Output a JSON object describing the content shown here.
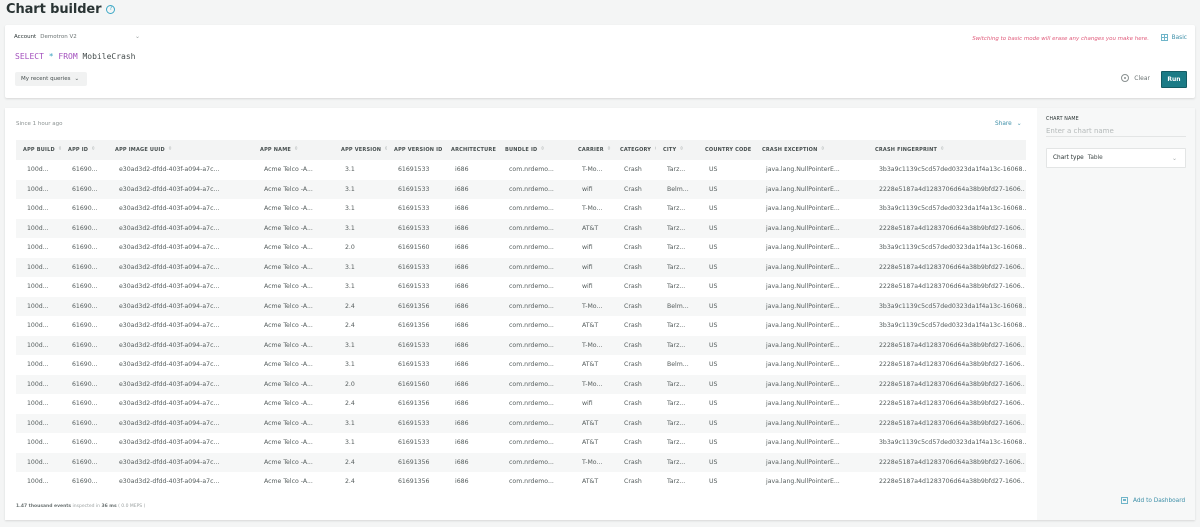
{
  "header": {
    "title": "Chart builder",
    "help_icon": "?"
  },
  "query": {
    "account_label": "Account",
    "account_value": "Demotron V2",
    "account_chevron": "⌄",
    "nrql": {
      "select": "SELECT",
      "star": "*",
      "from": "FROM",
      "table": "MobileCrash"
    },
    "recent_queries_label": "My recent queries",
    "recent_chevron": "⌄",
    "warning": "Switching to basic mode will erase any changes you make here.",
    "basic_label": "Basic",
    "clear_label": "Clear",
    "run_label": "Run",
    "accent_color": "#1b7b86"
  },
  "results": {
    "since": "Since 1 hour ago",
    "share_label": "Share",
    "share_chevron": "⌄",
    "sort_glyph": "⇳",
    "columns": [
      "APP BUILD",
      "APP ID",
      "APP IMAGE UUID",
      "APP NAME",
      "APP VERSION",
      "APP VERSION ID",
      "ARCHITECTURE",
      "BUNDLE ID",
      "CARRIER",
      "CATEGORY",
      "CITY",
      "COUNTRY CODE",
      "CRASH EXCEPTION",
      "CRASH FINGERPRINT"
    ],
    "rows": [
      [
        "100d...",
        "61690...",
        "e30ad3d2-dfdd-403f-a094-a7c...",
        "Acme Telco -A...",
        "3.1",
        "61691533",
        "i686",
        "com.nrdemo...",
        "T-Mo...",
        "Crash",
        "Tarz...",
        "US",
        "java.lang.NullPointerE...",
        "3b3a9c1139c5cd57ded0323da1f4a13c-16068.."
      ],
      [
        "100d...",
        "61690...",
        "e30ad3d2-dfdd-403f-a094-a7c...",
        "Acme Telco -A...",
        "3.1",
        "61691533",
        "i686",
        "com.nrdemo...",
        "wifi",
        "Crash",
        "Belm...",
        "US",
        "java.lang.NullPointerE...",
        "2228e5187a4d1283706d64a38b9bfd27-1606.."
      ],
      [
        "100d...",
        "61690...",
        "e30ad3d2-dfdd-403f-a094-a7c...",
        "Acme Telco -A...",
        "3.1",
        "61691533",
        "i686",
        "com.nrdemo...",
        "T-Mo...",
        "Crash",
        "Tarz...",
        "US",
        "java.lang.NullPointerE...",
        "3b3a9c1139c5cd57ded0323da1f4a13c-16068.."
      ],
      [
        "100d...",
        "61690...",
        "e30ad3d2-dfdd-403f-a094-a7c...",
        "Acme Telco -A...",
        "3.1",
        "61691533",
        "i686",
        "com.nrdemo...",
        "AT&T",
        "Crash",
        "Tarz...",
        "US",
        "java.lang.NullPointerE...",
        "2228e5187a4d1283706d64a38b9bfd27-1606.."
      ],
      [
        "100d...",
        "61690...",
        "e30ad3d2-dfdd-403f-a094-a7c...",
        "Acme Telco -A...",
        "2.0",
        "61691560",
        "i686",
        "com.nrdemo...",
        "wifi",
        "Crash",
        "Tarz...",
        "US",
        "java.lang.NullPointerE...",
        "3b3a9c1139c5cd57ded0323da1f4a13c-16068.."
      ],
      [
        "100d...",
        "61690...",
        "e30ad3d2-dfdd-403f-a094-a7c...",
        "Acme Telco -A...",
        "3.1",
        "61691533",
        "i686",
        "com.nrdemo...",
        "wifi",
        "Crash",
        "Tarz...",
        "US",
        "java.lang.NullPointerE...",
        "2228e5187a4d1283706d64a38b9bfd27-1606.."
      ],
      [
        "100d...",
        "61690...",
        "e30ad3d2-dfdd-403f-a094-a7c...",
        "Acme Telco -A...",
        "3.1",
        "61691533",
        "i686",
        "com.nrdemo...",
        "wifi",
        "Crash",
        "Tarz...",
        "US",
        "java.lang.NullPointerE...",
        "2228e5187a4d1283706d64a38b9bfd27-1606.."
      ],
      [
        "100d...",
        "61690...",
        "e30ad3d2-dfdd-403f-a094-a7c...",
        "Acme Telco -A...",
        "2.4",
        "61691356",
        "i686",
        "com.nrdemo...",
        "T-Mo...",
        "Crash",
        "Belm...",
        "US",
        "java.lang.NullPointerE...",
        "3b3a9c1139c5cd57ded0323da1f4a13c-16068.."
      ],
      [
        "100d...",
        "61690...",
        "e30ad3d2-dfdd-403f-a094-a7c...",
        "Acme Telco -A...",
        "2.4",
        "61691356",
        "i686",
        "com.nrdemo...",
        "AT&T",
        "Crash",
        "Tarz...",
        "US",
        "java.lang.NullPointerE...",
        "3b3a9c1139c5cd57ded0323da1f4a13c-16068.."
      ],
      [
        "100d...",
        "61690...",
        "e30ad3d2-dfdd-403f-a094-a7c...",
        "Acme Telco -A...",
        "3.1",
        "61691533",
        "i686",
        "com.nrdemo...",
        "T-Mo...",
        "Crash",
        "Tarz...",
        "US",
        "java.lang.NullPointerE...",
        "2228e5187a4d1283706d64a38b9bfd27-1606.."
      ],
      [
        "100d...",
        "61690...",
        "e30ad3d2-dfdd-403f-a094-a7c...",
        "Acme Telco -A...",
        "3.1",
        "61691533",
        "i686",
        "com.nrdemo...",
        "AT&T",
        "Crash",
        "Belm...",
        "US",
        "java.lang.NullPointerE...",
        "2228e5187a4d1283706d64a38b9bfd27-1606.."
      ],
      [
        "100d...",
        "61690...",
        "e30ad3d2-dfdd-403f-a094-a7c...",
        "Acme Telco -A...",
        "2.0",
        "61691560",
        "i686",
        "com.nrdemo...",
        "T-Mo...",
        "Crash",
        "Tarz...",
        "US",
        "java.lang.NullPointerE...",
        "2228e5187a4d1283706d64a38b9bfd27-1606.."
      ],
      [
        "100d...",
        "61690...",
        "e30ad3d2-dfdd-403f-a094-a7c...",
        "Acme Telco -A...",
        "2.4",
        "61691356",
        "i686",
        "com.nrdemo...",
        "wifi",
        "Crash",
        "Tarz...",
        "US",
        "java.lang.NullPointerE...",
        "2228e5187a4d1283706d64a38b9bfd27-1606.."
      ],
      [
        "100d...",
        "61690...",
        "e30ad3d2-dfdd-403f-a094-a7c...",
        "Acme Telco -A...",
        "3.1",
        "61691533",
        "i686",
        "com.nrdemo...",
        "AT&T",
        "Crash",
        "Tarz...",
        "US",
        "java.lang.NullPointerE...",
        "2228e5187a4d1283706d64a38b9bfd27-1606.."
      ],
      [
        "100d...",
        "61690...",
        "e30ad3d2-dfdd-403f-a094-a7c...",
        "Acme Telco -A...",
        "3.1",
        "61691533",
        "i686",
        "com.nrdemo...",
        "AT&T",
        "Crash",
        "Tarz...",
        "US",
        "java.lang.NullPointerE...",
        "3b3a9c1139c5cd57ded0323da1f4a13c-16068.."
      ],
      [
        "100d...",
        "61690...",
        "e30ad3d2-dfdd-403f-a094-a7c...",
        "Acme Telco -A...",
        "2.4",
        "61691356",
        "i686",
        "com.nrdemo...",
        "T-Mo...",
        "Crash",
        "Tarz...",
        "US",
        "java.lang.NullPointerE...",
        "2228e5187a4d1283706d64a38b9bfd27-1606.."
      ],
      [
        "100d...",
        "61690...",
        "e30ad3d2-dfdd-403f-a094-a7c...",
        "Acme Telco -A...",
        "2.4",
        "61691356",
        "i686",
        "com.nrdemo...",
        "AT&T",
        "Crash",
        "Tarz...",
        "US",
        "java.lang.NullPointerE...",
        "2228e5187a4d1283706d64a38b9bfd27-1606.."
      ]
    ],
    "footer": {
      "events": "1.47 thousand events",
      "inspected": " inspected in ",
      "duration": "36 ms",
      "rate": " ( 0.0 MEPS )"
    }
  },
  "side_panel": {
    "chart_name_label": "CHART NAME",
    "chart_name_placeholder": "Enter a chart name",
    "chart_name_value": "",
    "chart_type_label": "Chart type",
    "chart_type_value": "Table",
    "chart_type_chevron": "⌄",
    "add_to_dashboard_label": "Add to Dashboard"
  }
}
